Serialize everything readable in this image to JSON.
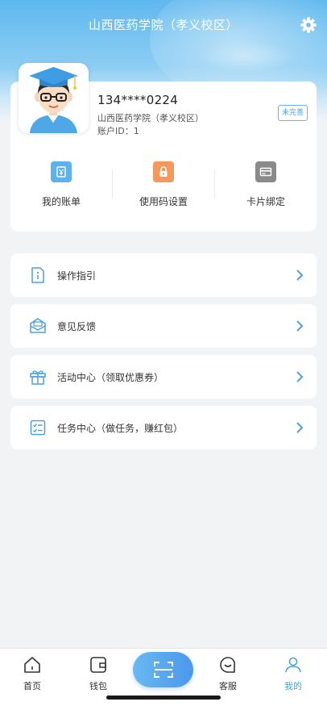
{
  "header": {
    "title": "山西医药学院（孝义校区）"
  },
  "profile": {
    "phone": "134****0224",
    "school": "山西医药学院（孝义校区）",
    "account_id": "账户ID：1",
    "badge": "未完善"
  },
  "quick_actions": [
    {
      "label": "我的账单",
      "icon": "bill-icon",
      "color": "#5bb2ee"
    },
    {
      "label": "使用码设置",
      "icon": "lock-icon",
      "color": "#f6975b"
    },
    {
      "label": "卡片绑定",
      "icon": "card-icon",
      "color": "#8a8a8a"
    }
  ],
  "menu": [
    {
      "label": "操作指引",
      "icon": "guide-icon"
    },
    {
      "label": "意见反馈",
      "icon": "feedback-icon"
    },
    {
      "label": "活动中心（领取优惠券）",
      "icon": "gift-icon"
    },
    {
      "label": "任务中心（做任务，赚红包）",
      "icon": "task-list-icon"
    }
  ],
  "tabbar": [
    {
      "label": "首页",
      "icon": "home-icon"
    },
    {
      "label": "钱包",
      "icon": "wallet-icon"
    },
    {
      "label": "客服",
      "icon": "customer-service-icon"
    },
    {
      "label": "我的",
      "icon": "profile-icon",
      "active": true
    }
  ],
  "colors": {
    "accent": "#4aa1df",
    "header": "#5fb8ee"
  }
}
